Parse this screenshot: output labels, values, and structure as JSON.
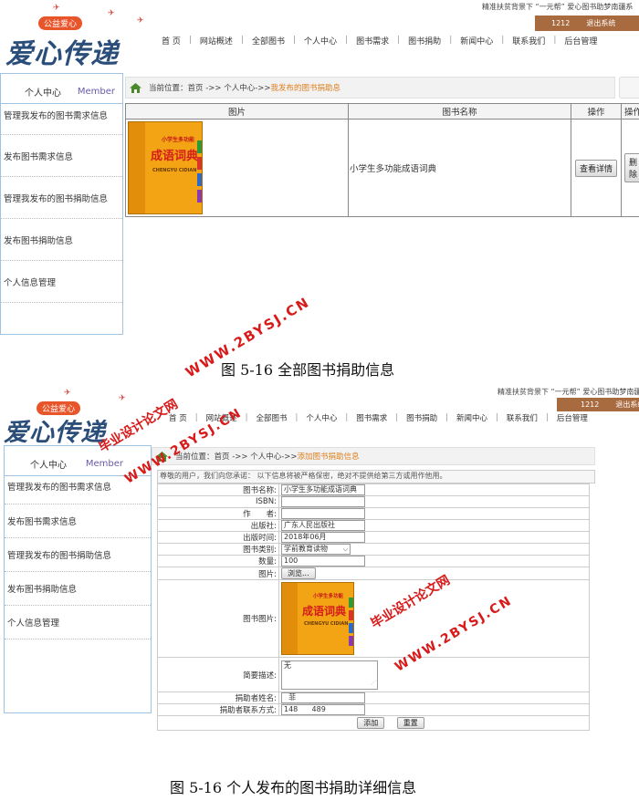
{
  "site": {
    "logo_badge": "公益爱心",
    "logo_brand": "爱心传递",
    "tagline": "精准扶贫背景下 “一元帮” 爱心图书助梦南疆系",
    "tagline2": "精准扶贫背景下 “一元帮” 爱心图书助梦南疆系",
    "user_id": "1212",
    "logout": "退出系统",
    "nav": [
      "首 页",
      "网站概述",
      "全部图书",
      "个人中心",
      "图书需求",
      "图书捐助",
      "新闻中心",
      "联系我们",
      "后台管理"
    ]
  },
  "sidebar": {
    "title": "个人中心",
    "subtitle": "Member",
    "links": [
      "管理我发布的图书需求信息",
      "发布图书需求信息",
      "管理我发布的图书捐助信息",
      "发布图书捐助信息",
      "个人信息管理"
    ]
  },
  "shot1": {
    "crumb_prefix": "当前位置：首页 ->> 个人中心->> ",
    "crumb_current": "我发布的图书捐助息",
    "table_headers": [
      "图片",
      "图书名称",
      "操作",
      "操作"
    ],
    "row": {
      "book_name": "小学生多功能成语词典",
      "view_button": "查看详情",
      "delete_button": "删除"
    },
    "caption": "图 5-16  全部图书捐助信息"
  },
  "book_cover": {
    "title": "成语词典",
    "top_label": "小学生多功能",
    "pinyin": "CHENGYU CIDIAN"
  },
  "shot2": {
    "crumb_prefix": "当前位置：首页 ->> 个人中心->> ",
    "crumb_current": "添加图书捐助信息",
    "notice": "尊敬的用户，我们向您承诺： 以下信息将被严格保密，绝对不提供给第三方或用作他用。",
    "fields": {
      "book_name": {
        "label": "图书名称:",
        "value": "小学生多功能成语词典"
      },
      "isbn": {
        "label": "ISBN:",
        "value": ""
      },
      "author": {
        "label": "作　　者:",
        "value": ""
      },
      "publisher": {
        "label": "出版社:",
        "value": "广东人民出版社"
      },
      "pub_date": {
        "label": "出版时间:",
        "value": "2018年06月"
      },
      "category": {
        "label": "图书类别:",
        "value": "学前教育读物"
      },
      "quantity": {
        "label": "数量:",
        "value": "100"
      },
      "image": {
        "label": "图片:",
        "button": "浏览..."
      },
      "book_image": {
        "label": "图书图片:"
      },
      "description": {
        "label": "简要描述:",
        "value": "无"
      },
      "donor_name": {
        "label": "捐助者姓名:",
        "value": "菲"
      },
      "donor_contact": {
        "label": "捐助者联系方式:",
        "value": "148      489"
      }
    },
    "add_button": "添加",
    "reset_button": "重置",
    "caption": "图 5-16   个人发布的图书捐助详细信息"
  },
  "watermarks": [
    "WWW.2BYSJ.CN",
    "毕业设计论文网",
    "WWW.2BYSJ.CN",
    "毕业设计论文网",
    "WWW.2BYSJ.CN"
  ],
  "colors": {
    "sidebar_border": "#9fc3e3",
    "userbar": "#a86a3f",
    "crumb_current": "#e08020",
    "watermark": "#d81a1a",
    "book_cover": "#f2a414"
  },
  "icons": [
    "home-icon",
    "dropdown-arrow-icon",
    "resize-grip-icon"
  ]
}
